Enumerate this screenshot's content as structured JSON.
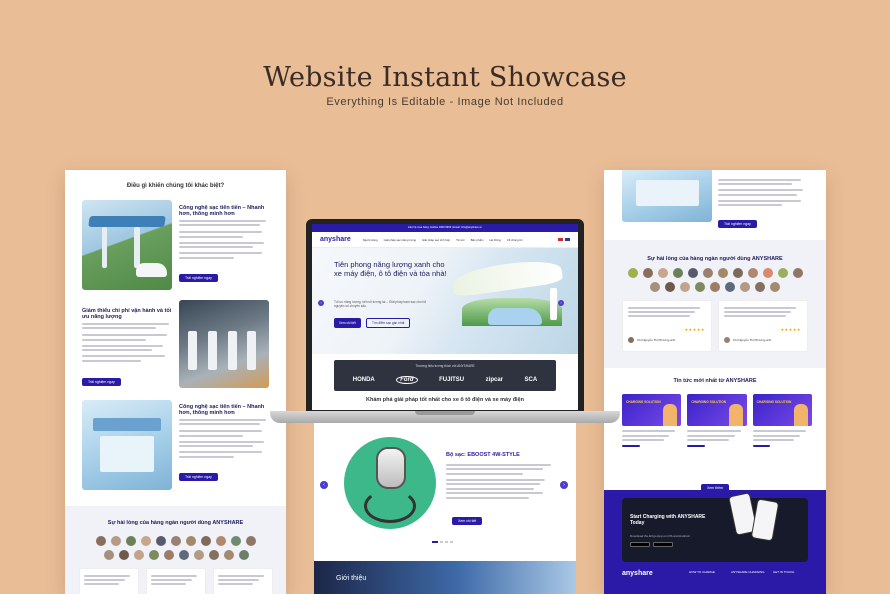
{
  "showcase": {
    "title": "Website Instant Showcase",
    "subtitle": "Everything Is Editable  -  Image Not Included"
  },
  "left_panel": {
    "heading": "Điều gì khiến chúng tôi khác biệt?",
    "feature1_title": "Công nghệ sạc tiên tiến – Nhanh hơn, thông minh hơn",
    "feature1_button": "Trải nghiệm ngay",
    "feature2_title": "Giảm thiểu chi phí vận hành và tối ưu năng lượng",
    "feature2_button": "Trải nghiệm ngay",
    "feature3_title": "Công nghệ sạc tiên tiến – Nhanh hơn, thông minh hơn",
    "feature3_button": "Trải nghiệm ngay",
    "reviews_heading": "Sự hài lòng của hàng ngàn người dùng ANYSHARE"
  },
  "laptop": {
    "topbar": "Liên hệ mua hàng: Hotline 1800 6999 | Email: info@anyshare.vn",
    "logo": "anyshare",
    "nav": [
      "Người dùng",
      "Giải pháp sạc năng lượng",
      "Giải pháp sạc tích hợp",
      "Tin tức",
      "Bản phẩm",
      "Hệ thống",
      "Về chúng tôi"
    ],
    "hero_title": "Tiên phong năng lượng xanh cho xe máy điện, ô tô điện và tòa nhà!",
    "hero_text": "Tối ưu năng lượng, kết nối tương lai – Giải pháp trạm sạc cho hệ nguyên số chuyên sâu",
    "btn_primary": "Xem chi tiết",
    "btn_secondary": "Tìm điểm sạc gần nhất",
    "partners_label": "Thương hiệu tương thích với ANYSHARE",
    "partners": [
      "HONDA",
      "Ford",
      "FUJITSU",
      "zipcar",
      "SCA"
    ],
    "explore": "Khám phá giải pháp tốt nhất cho xe ô tô điện và xe máy điện"
  },
  "below_laptop": {
    "product_title": "Bộ sạc: EBOOST 4W-STYLE",
    "product_button": "Xem chi tiết",
    "intro": "Giới thiệu"
  },
  "right_panel": {
    "button": "Trải nghiệm ngay",
    "reviews_heading": "Sự hài lòng của hàng ngàn người dùng ANYSHARE",
    "reviewer1": "Chị Nguyễn Thị Phương anh",
    "reviewer2": "Chị Nguyễn Thị Phương anh",
    "news_heading": "Tin tức mới nhất từ ANYSHARE",
    "news_card_label": "CHARGING SOLUTION",
    "news_button": "Xem thêm",
    "app_title": "Start Charging with ANYSHARE Today",
    "app_text": "Download the EVgo App on iOS and Android",
    "footer_logo": "anyshare",
    "footer_cols": [
      "HOW TO CHARGE",
      "ANYSHARE CHARGING",
      "GET IN TOUCH"
    ]
  },
  "colors": {
    "background": "#e9bd96",
    "brand": "#2a1ba6",
    "green": "#3cb88a"
  }
}
